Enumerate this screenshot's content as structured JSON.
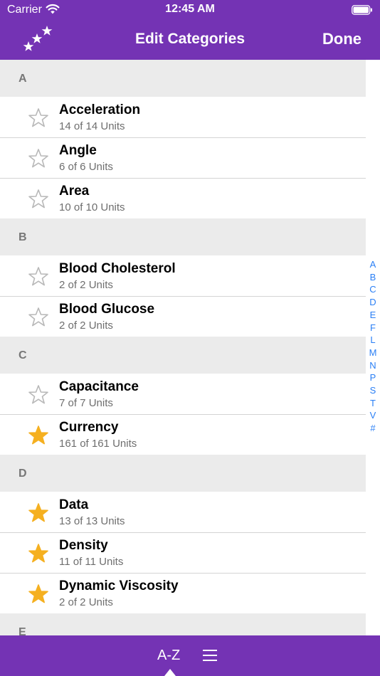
{
  "status_bar": {
    "carrier": "Carrier",
    "time": "12:45 AM"
  },
  "nav": {
    "title": "Edit Categories",
    "done_label": "Done"
  },
  "sections": [
    {
      "letter": "A",
      "rows": [
        {
          "name": "Acceleration",
          "units": "14 of 14 Units",
          "favorite": false
        },
        {
          "name": "Angle",
          "units": "6 of 6 Units",
          "favorite": false
        },
        {
          "name": "Area",
          "units": "10 of 10 Units",
          "favorite": false
        }
      ]
    },
    {
      "letter": "B",
      "rows": [
        {
          "name": "Blood Cholesterol",
          "units": "2 of 2 Units",
          "favorite": false
        },
        {
          "name": "Blood Glucose",
          "units": "2 of 2 Units",
          "favorite": false
        }
      ]
    },
    {
      "letter": "C",
      "rows": [
        {
          "name": "Capacitance",
          "units": "7 of 7 Units",
          "favorite": false
        },
        {
          "name": "Currency",
          "units": "161 of 161 Units",
          "favorite": true
        }
      ]
    },
    {
      "letter": "D",
      "rows": [
        {
          "name": "Data",
          "units": "13 of 13 Units",
          "favorite": true
        },
        {
          "name": "Density",
          "units": "11 of 11 Units",
          "favorite": true
        },
        {
          "name": "Dynamic Viscosity",
          "units": "2 of 2 Units",
          "favorite": true
        }
      ]
    },
    {
      "letter": "E",
      "rows": []
    }
  ],
  "index_letters": [
    "A",
    "B",
    "C",
    "D",
    "E",
    "F",
    "L",
    "M",
    "N",
    "P",
    "S",
    "T",
    "V",
    "#"
  ],
  "bottom_bar": {
    "az_label": "A-Z",
    "menu_icon": "list-icon"
  },
  "colors": {
    "brand_purple": "#7433b4",
    "favorite_star": "#f5b020",
    "outline_star": "#b8b8b8",
    "index_blue": "#2a7ff5"
  }
}
